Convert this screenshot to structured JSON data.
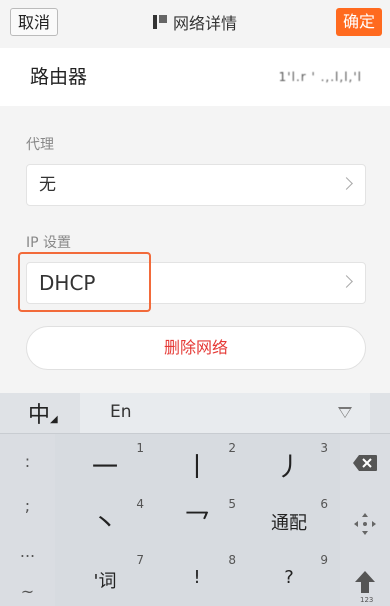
{
  "nav": {
    "cancel": "取消",
    "title": "网络详情",
    "confirm": "确定"
  },
  "router": {
    "label": "路由器",
    "value": "1'l.r ' .,.l,l,'l"
  },
  "proxy": {
    "section": "代理",
    "value": "无"
  },
  "ip": {
    "section": "IP 设置",
    "value": "DHCP"
  },
  "delete_label": "删除网络",
  "colors": {
    "accent": "#ff6a1f",
    "delete": "#e53935",
    "highlight": "#f26a3a"
  },
  "keyboard": {
    "zh": "中",
    "en": "En",
    "left_symbols": [
      ":",
      ";",
      "...",
      "~"
    ],
    "keys": [
      {
        "sym": "一",
        "num": "1"
      },
      {
        "sym": "丨",
        "num": "2"
      },
      {
        "sym": "丿",
        "num": "3"
      },
      {
        "sym": "丶",
        "num": "4"
      },
      {
        "sym": "乛",
        "num": "5"
      },
      {
        "sym": "通配",
        "num": "6"
      },
      {
        "sym": "'词",
        "num": "7"
      },
      {
        "sym": "!",
        "num": "8"
      },
      {
        "sym": "?",
        "num": "9"
      }
    ],
    "shift_label": "123",
    "icons": [
      "backspace-icon",
      "move-cursor-icon",
      "shift-icon",
      "collapse-keyboard-icon"
    ]
  }
}
